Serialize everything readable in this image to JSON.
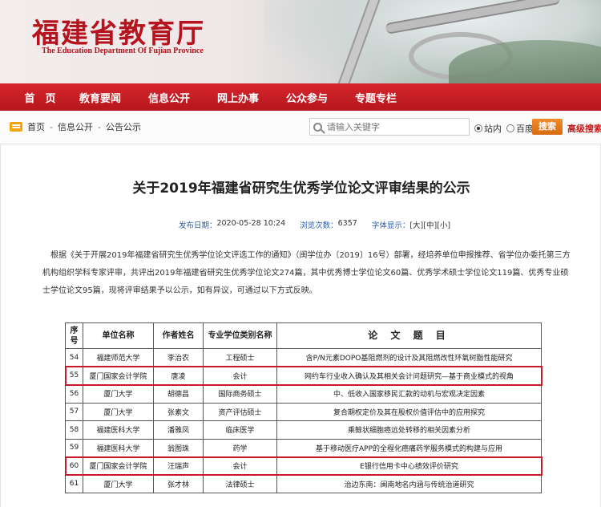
{
  "banner": {
    "title_cn": "福建省教育厅",
    "title_en": "The Education Department Of Fujian Province"
  },
  "nav": {
    "items": [
      "首　页",
      "教育要闻",
      "信息公开",
      "网上办事",
      "公众参与",
      "专题专栏"
    ]
  },
  "breadcrumb": [
    "首页",
    "信息公开",
    "公告公示"
  ],
  "search": {
    "placeholder": "请输入关键字",
    "options": [
      "站内",
      "百度"
    ],
    "selected": "站内",
    "button": "搜索",
    "advanced": "高级搜索"
  },
  "article": {
    "title": "关于2019年福建省研究生优秀学位论文评审结果的公示",
    "publish_label": "发布日期：",
    "publish_date": "2020-05-28 10:24",
    "views_label": "浏览次数：",
    "views": "6357",
    "font_label": "字体显示：",
    "font_sizes": [
      "[大]",
      "[中]",
      "[小]"
    ],
    "paragraph": "根据《关于开展2019年福建省研究生优秀学位论文评选工作的通知》（闽学位办〔2019〕16号）部署，经培养单位申报推荐、省学位办委托第三方机构组织学科专家评审，共评出2019年福建省研究生优秀学位论文274篇，其中优秀博士学位论文60篇、优秀学术硕士学位论文119篇、优秀专业硕士学位论文95篇，现将评审结果予以公示，如有异议，可通过以下方式反映。"
  },
  "table": {
    "headers": [
      "序号",
      "单位名称",
      "作者姓名",
      "专业学位类别名称",
      "论 文 题 目"
    ],
    "rows": [
      {
        "no": "54",
        "unit": "福建师范大学",
        "author": "李治农",
        "category": "工程硕士",
        "topic": "含P/N元素DOPO基阻燃剂的设计及其阻燃改性环氧树脂性能研究",
        "highlight": false
      },
      {
        "no": "55",
        "unit": "厦门国家会计学院",
        "author": "唐凌",
        "category": "会计",
        "topic": "网约车行业收入确认及其相关会计问题研究—基于商业模式的视角",
        "highlight": true
      },
      {
        "no": "56",
        "unit": "厦门大学",
        "author": "胡德昌",
        "category": "国际商务硕士",
        "topic": "中、低收入国家移民汇款的动机与宏观决定因素",
        "highlight": false
      },
      {
        "no": "57",
        "unit": "厦门大学",
        "author": "张素文",
        "category": "资产评估硕士",
        "topic": "复合期权定价及其在股权价值评估中的应用探究",
        "highlight": false
      },
      {
        "no": "58",
        "unit": "福建医科大学",
        "author": "潘雅凤",
        "category": "临床医学",
        "topic": "乘鲸状细胞癌远处转移的相关因素分析",
        "highlight": false
      },
      {
        "no": "59",
        "unit": "福建医科大学",
        "author": "翁图珠",
        "category": "药学",
        "topic": "基于移动医疗APP的全程化癌痛药学服务模式的构建与应用",
        "highlight": false
      },
      {
        "no": "60",
        "unit": "厦门国家会计学院",
        "author": "汪瑞声",
        "category": "会计",
        "topic": "E银行信用卡中心绩效评价研究",
        "highlight": true
      },
      {
        "no": "61",
        "unit": "厦门大学",
        "author": "张才林",
        "category": "法律硕士",
        "topic": "治边东南：闽南地名内涵与传统治道研究",
        "highlight": false
      }
    ]
  }
}
